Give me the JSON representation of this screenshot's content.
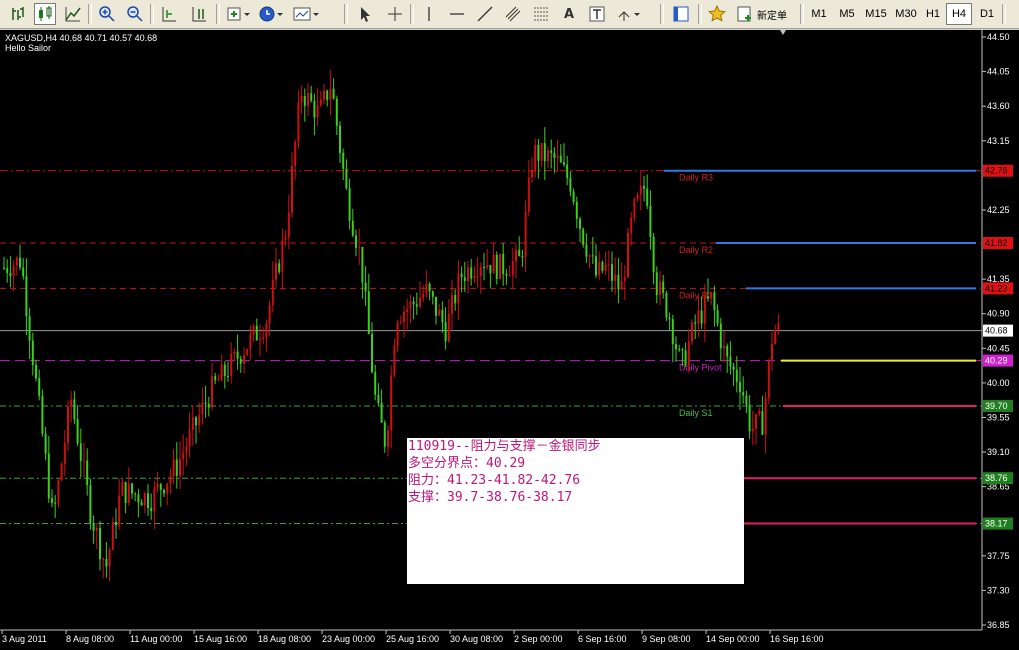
{
  "toolbar": {
    "new_order_label": "新定单",
    "timeframes": [
      "M1",
      "M5",
      "M15",
      "M30",
      "H1",
      "H4",
      "D1"
    ],
    "active_timeframe": "H4"
  },
  "chart": {
    "symbol_line": "XAGUSD,H4  40.68 40.71 40.57 40.68",
    "ea_name": "Hello Sailor",
    "background": "#000000",
    "bull_color": "#d01010",
    "bear_color": "#3cd01c",
    "current_price": "40.68",
    "price_ticks": [
      "44.50",
      "44.05",
      "43.60",
      "43.15",
      "42.25",
      "41.35",
      "40.90",
      "40.45",
      "40.00",
      "39.55",
      "39.10",
      "38.65",
      "37.75",
      "37.30",
      "36.85"
    ],
    "time_ticks": [
      "3 Aug 2011",
      "8 Aug 08:00",
      "11 Aug 00:00",
      "15 Aug 16:00",
      "18 Aug 08:00",
      "23 Aug 00:00",
      "25 Aug 16:00",
      "30 Aug 08:00",
      "2 Sep 00:00",
      "6 Sep 16:00",
      "9 Sep 08:00",
      "14 Sep 00:00",
      "16 Sep 16:00"
    ],
    "pivot_labels": {
      "r3": "Daily R3",
      "r2": "Daily R2",
      "r1": "Daily R1",
      "pivot": "Daily Pivot",
      "s1": "Daily S1"
    },
    "level_tags": [
      {
        "value": "42.76",
        "bg": "#e01010",
        "fg": "#000000"
      },
      {
        "value": "41.82",
        "bg": "#e01010",
        "fg": "#000000"
      },
      {
        "value": "41.23",
        "bg": "#e01010",
        "fg": "#000000"
      },
      {
        "value": "40.68",
        "bg": "#ffffff",
        "fg": "#000000"
      },
      {
        "value": "40.29",
        "bg": "#d020d0",
        "fg": "#ffffff"
      },
      {
        "value": "39.70",
        "bg": "#208020",
        "fg": "#ffffff"
      },
      {
        "value": "38.76",
        "bg": "#208020",
        "fg": "#ffffff"
      },
      {
        "value": "38.17",
        "bg": "#208020",
        "fg": "#ffffff"
      }
    ]
  },
  "note": {
    "line1": "110919--阻力与支撑－金银同步",
    "line2": "多空分界点：40.29",
    "line3": "阻力：41.23-41.82-42.76",
    "line4": "支撑：39.7-38.76-38.17"
  }
}
